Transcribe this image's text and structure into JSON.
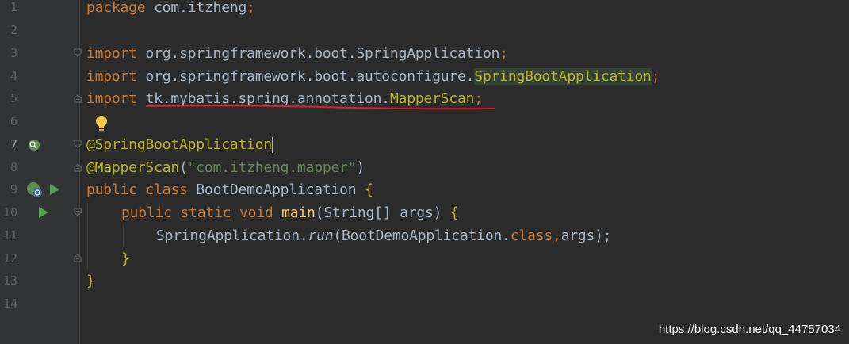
{
  "editor": {
    "line_numbers": [
      "1",
      "2",
      "3",
      "4",
      "5",
      "6",
      "7",
      "8",
      "9",
      "10",
      "11",
      "12",
      "13",
      "14"
    ],
    "active_line": "7",
    "lines": {
      "l1": {
        "kw": "package",
        "rest": " com.itzheng",
        "semi": ";"
      },
      "l3": {
        "kw": "import",
        "rest": " org.springframework.boot.SpringApplication",
        "semi": ";"
      },
      "l4": {
        "kw": "import",
        "rest": " org.springframework.boot.autoconfigure.",
        "unused": "SpringBootApplication",
        "semi": ";"
      },
      "l5": {
        "kw": "import",
        "sp": " ",
        "pkg": "tk.mybatis.spring.annotation.",
        "unused": "MapperScan",
        "semi": ";"
      },
      "l7": {
        "ann": "@SpringBootApplication"
      },
      "l8": {
        "ann": "@MapperScan",
        "open": "(",
        "str": "\"com.itzheng.mapper\"",
        "close": ")"
      },
      "l9": {
        "kw1": "public",
        "kw2": "class",
        "name": " BootDemoApplication ",
        "brace": "{"
      },
      "l10": {
        "kw1": "public",
        "kw2": "static",
        "kw3": "void",
        "fn": "main",
        "params": "(String[] args) ",
        "brace": "{"
      },
      "l11": {
        "cls": "SpringApplication.",
        "call": "run",
        "args1": "(BootDemoApplication.",
        "kw": "class",
        "comma": ",",
        "args2": "args);"
      },
      "l12": {
        "brace": "}"
      },
      "l13": {
        "brace": "}"
      }
    },
    "gutter_icons": {
      "line7": "spring-bean-icon",
      "line9_bean": "spring-boot-icon",
      "line9_run": "run-icon",
      "line10_run": "run-icon",
      "line6_hint": "lightbulb-icon"
    },
    "colors": {
      "background": "#2b2b2b",
      "gutter": "#313335",
      "keyword": "#cc7832",
      "annotation": "#bbb529",
      "string": "#6a8759",
      "method": "#ffc66d",
      "error_underline": "#e0202a"
    }
  },
  "watermark": "https://blog.csdn.net/qq_44757034"
}
